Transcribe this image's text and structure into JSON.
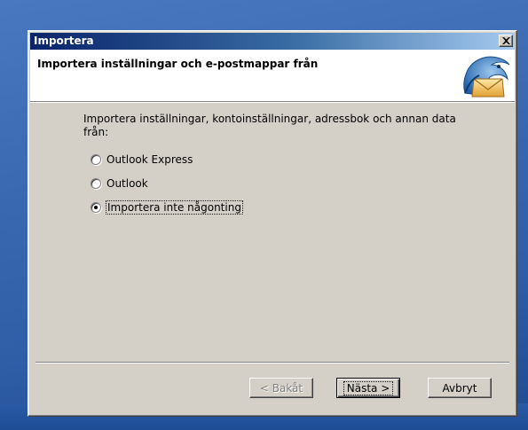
{
  "window": {
    "title": "Importera"
  },
  "header": {
    "heading": "Importera inställningar och e-postmappar från"
  },
  "main": {
    "description": "Importera inställningar, kontoinställningar, adressbok och annan data från:",
    "options": [
      {
        "label": "Outlook Express",
        "checked": false
      },
      {
        "label": "Outlook",
        "checked": false
      },
      {
        "label": "Importera inte någonting",
        "checked": true
      }
    ]
  },
  "buttons": {
    "back": "< Bakåt",
    "next": "Nästa >",
    "cancel": "Avbryt"
  },
  "icons": {
    "logo": "thunderbird-logo-icon",
    "close": "close-icon"
  }
}
